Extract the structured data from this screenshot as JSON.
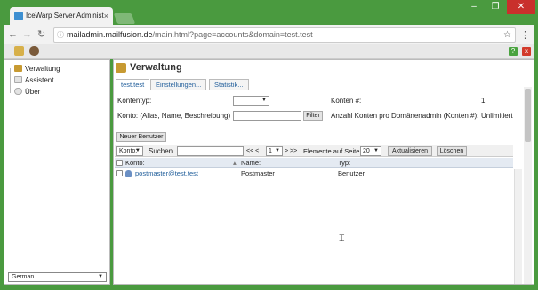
{
  "browser": {
    "tab_title": "IceWarp Server Administ",
    "tab_close": "×",
    "url_domain": "mailadmin.mailfusion.de",
    "url_path": "/main.html?page=accounts&domain=test.test",
    "min": "–",
    "max": "❐",
    "close": "✕"
  },
  "toolbar": {
    "help": "?",
    "close": "x"
  },
  "sidebar": {
    "items": [
      {
        "label": "Verwaltung"
      },
      {
        "label": "Assistent"
      },
      {
        "label": "Über"
      }
    ],
    "language": "German"
  },
  "main": {
    "title": "Verwaltung",
    "tabs": [
      {
        "label": "test.test"
      },
      {
        "label": "Einstellungen..."
      },
      {
        "label": "Statistik..."
      }
    ],
    "form": {
      "kontentyp_label": "Kontentyp:",
      "konto_label": "Konto: (Alias, Name, Beschreibung)",
      "filter_button": "Filter",
      "konten_label": "Konten #:",
      "konten_value": "1",
      "anzahl_label": "Anzahl Konten pro Domänenadmin (Konten #):",
      "anzahl_value": "Unlimitiert",
      "new_user_button": "Neuer Benutzer"
    },
    "gridbar": {
      "field_select": "Konto:",
      "search_label": "Suchen...",
      "pager_prev": "<< <",
      "page_select": "1",
      "pager_next": "> >>",
      "per_page_label": "Elemente auf Seite:",
      "per_page_value": "20",
      "refresh_button": "Aktualisieren",
      "delete_button": "Löschen"
    },
    "grid": {
      "columns": [
        "Konto:",
        "Name:",
        "Typ:"
      ],
      "rows": [
        {
          "konto": "postmaster@test.test",
          "name": "Postmaster",
          "typ": "Benutzer"
        }
      ]
    }
  }
}
